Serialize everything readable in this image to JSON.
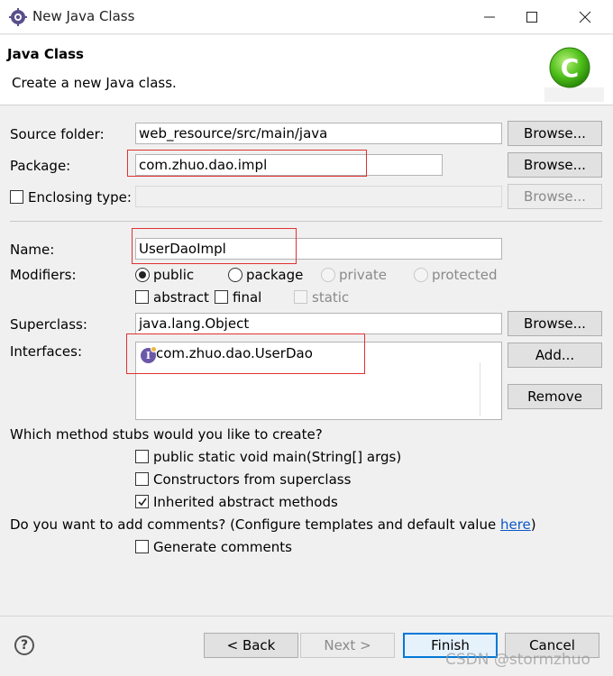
{
  "window": {
    "title": "New Java Class",
    "minimize_icon": "minimize-icon",
    "maximize_icon": "maximize-icon",
    "close_icon": "close-icon"
  },
  "header": {
    "title": "Java Class",
    "description": "Create a new Java class.",
    "logo_icon": "java-class-wizard-logo"
  },
  "source_folder": {
    "label": "Source folder:",
    "value": "web_resource/src/main/java",
    "browse_label": "Browse..."
  },
  "package": {
    "label": "Package:",
    "value": "com.zhuo.dao.impl",
    "browse_label": "Browse..."
  },
  "enclosing_type": {
    "label": "Enclosing type:",
    "value": "",
    "browse_label": "Browse..."
  },
  "name": {
    "label": "Name:",
    "value": "UserDaoImpl"
  },
  "modifiers": {
    "label": "Modifiers:",
    "public": "public",
    "package": "package",
    "private": "private",
    "protected": "protected",
    "abstract": "abstract",
    "final": "final",
    "static": "static"
  },
  "superclass": {
    "label": "Superclass:",
    "value": "java.lang.Object",
    "browse_label": "Browse..."
  },
  "interfaces": {
    "label": "Interfaces:",
    "items": [
      "com.zhuo.dao.UserDao"
    ],
    "add_label": "Add...",
    "remove_label": "Remove"
  },
  "stubs": {
    "question": "Which method stubs would you like to create?",
    "main": "public static void main(String[] args)",
    "constructors": "Constructors from superclass",
    "inherited": "Inherited abstract methods"
  },
  "comments": {
    "question": "Do you want to add comments? (Configure templates and default value ",
    "link": "here",
    "question_end": ")",
    "generate": "Generate comments"
  },
  "footer": {
    "help_icon": "help-icon",
    "back": "< Back",
    "next": "Next >",
    "finish": "Finish",
    "cancel": "Cancel"
  },
  "watermark": "CSDN @stormzhuo",
  "colors": {
    "annotation_red": "#e03131",
    "accent": "#0078d7",
    "link": "#0b57c7"
  }
}
